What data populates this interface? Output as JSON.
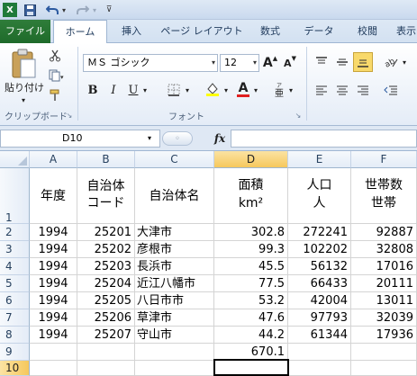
{
  "ribbon": {
    "tabs": [
      "ファイル",
      "ホーム",
      "挿入",
      "ページ レイアウト",
      "数式",
      "データ",
      "校閲",
      "表示"
    ],
    "paste_label": "貼り付け",
    "clipboard_group": "クリップボード",
    "font_group": "フォント",
    "font_name": "ＭＳ ゴシック",
    "font_size": "12",
    "bold": "B",
    "italic": "I",
    "underline": "U",
    "font_color_glyph": "A",
    "grow_font": "A",
    "shrink_font": "A"
  },
  "formula_bar": {
    "name_box": "D10",
    "fx": "fx",
    "content": ""
  },
  "grid": {
    "columns": [
      "A",
      "B",
      "C",
      "D",
      "E",
      "F"
    ],
    "rows": [
      "1",
      "2",
      "3",
      "4",
      "5",
      "6",
      "7",
      "8",
      "9",
      "10"
    ],
    "header": {
      "a": "年度",
      "b1": "自治体",
      "b2": "コード",
      "c": "自治体名",
      "d1": "面積",
      "d2": "km²",
      "e1": "人口",
      "e2": "人",
      "f1": "世帯数",
      "f2": "世帯"
    },
    "data": [
      [
        "1994",
        "25201",
        "大津市",
        "302.8",
        "272241",
        "92887"
      ],
      [
        "1994",
        "25202",
        "彦根市",
        "99.3",
        "102202",
        "32808"
      ],
      [
        "1994",
        "25203",
        "長浜市",
        "45.5",
        "56132",
        "17016"
      ],
      [
        "1994",
        "25204",
        "近江八幡市",
        "77.5",
        "66433",
        "20111"
      ],
      [
        "1994",
        "25205",
        "八日市市",
        "53.2",
        "42004",
        "13011"
      ],
      [
        "1994",
        "25206",
        "草津市",
        "47.6",
        "97793",
        "32039"
      ],
      [
        "1994",
        "25207",
        "守山市",
        "44.2",
        "61344",
        "17936"
      ]
    ],
    "total_area": "670.1"
  }
}
